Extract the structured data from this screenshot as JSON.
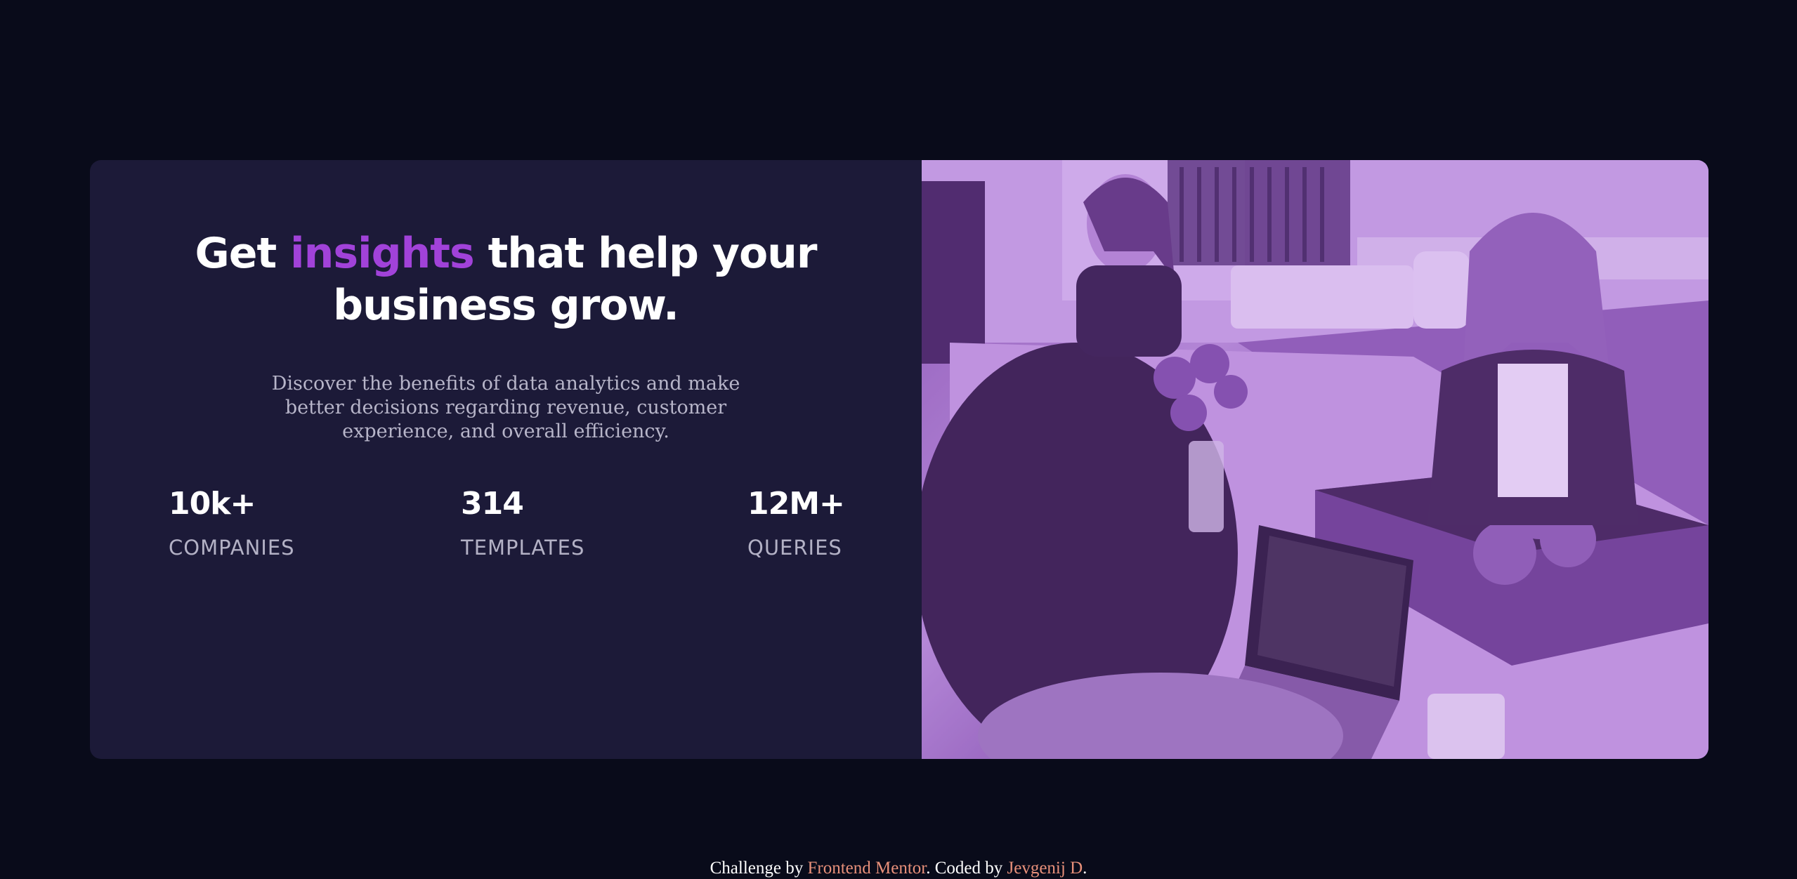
{
  "hero": {
    "title_before": "Get",
    "title_accent": "insights",
    "title_after": "that help your business grow.",
    "description": "Discover the benefits of data analytics and make better decisions regarding revenue, customer experience, and overall efficiency.",
    "accent_color": "#a142d9"
  },
  "stats": [
    {
      "value": "10k+",
      "label": "COMPANIES"
    },
    {
      "value": "314",
      "label": "TEMPLATES"
    },
    {
      "value": "12M+",
      "label": "QUERIES"
    }
  ],
  "image": {
    "subject": "photo-of-women-working-at-laptops",
    "tint_color": "#aa5cdb"
  },
  "footer": {
    "challenge_text": "Challenge by",
    "challenge_link": "Frontend Mentor",
    "coded_text": ". Coded by",
    "coder_link": "Jevgenij D",
    "end_text": ".",
    "link_color": "#e8907a"
  }
}
